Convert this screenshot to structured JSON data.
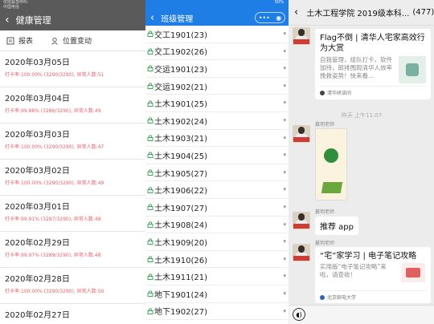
{
  "panel1": {
    "status": [
      "仅限紧急呼叫",
      "中国电信"
    ],
    "title": "健康管理",
    "toolbar": {
      "report": "报表",
      "location_change": "位置变动"
    },
    "records": [
      {
        "date": "2020年03月05日",
        "rate": "打卡率:100.00% (3290/3290), 异常人数:51"
      },
      {
        "date": "2020年03月04日",
        "rate": "打卡率:99.88% (3286/3290), 异常人数:49"
      },
      {
        "date": "2020年03月03日",
        "rate": "打卡率:100.00% (3290/3290), 异常人数:47"
      },
      {
        "date": "2020年03月02日",
        "rate": "打卡率:100.00% (3290/3290), 异常人数:49"
      },
      {
        "date": "2020年03月01日",
        "rate": "打卡率:99.91% (3287/3290), 异常人数:48"
      },
      {
        "date": "2020年02月29日",
        "rate": "打卡率:99.97% (3289/3290), 异常人数:48"
      },
      {
        "date": "2020年02月28日",
        "rate": "打卡率:100.00% (3290/3290), 异常人数:50"
      },
      {
        "date": "2020年02月27日",
        "rate": ""
      }
    ]
  },
  "panel2": {
    "status": "50%",
    "title": "班级管理",
    "classes": [
      "交工1901(23)",
      "交工1902(26)",
      "交运1901(23)",
      "交运1902(21)",
      "土木1901(25)",
      "土木1902(24)",
      "土木1903(21)",
      "土木1904(25)",
      "土木1905(27)",
      "土木1906(22)",
      "土木1907(27)",
      "土木1908(24)",
      "土木1909(20)",
      "土木1910(26)",
      "土木1911(21)",
      "地下1901(24)",
      "地下1902(27)"
    ]
  },
  "panel3": {
    "chat_title": "土木工程学院 2019级本科...",
    "member_count": "(477)",
    "sender": "綦玥老师",
    "card1": {
      "title": "Flag不倒 | 清华人宅家高效行为大赏",
      "desc": "自我管理，组队打卡，软件加持，郎排围观清华人效率挽救姿势！快来看...",
      "source": "清华研读间"
    },
    "timestamp": "昨天 上午11:07",
    "bubble": "推荐 app",
    "card2": {
      "title": "“宅”家学习 | 电子笔记攻略",
      "desc": "实用版“电子笔记攻略”来啦，请查收！",
      "source": "北京邮电大学"
    },
    "colors": {
      "accent_blue": "#1f7ee6",
      "rate_red": "#e8606a",
      "lock_green": "#2aa34a"
    }
  }
}
